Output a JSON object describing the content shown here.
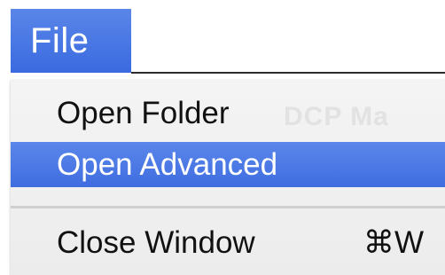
{
  "menubar": {
    "file_label": "File",
    "accent_color": "#3f6de0"
  },
  "menu": {
    "background_hint_text": "DCP Ma",
    "items": [
      {
        "label": "Open Folder",
        "shortcut": "",
        "highlighted": false
      },
      {
        "label": "Open Advanced",
        "shortcut": "",
        "highlighted": true
      },
      {
        "label": "Close Window",
        "shortcut": "⌘W",
        "highlighted": false
      }
    ]
  }
}
